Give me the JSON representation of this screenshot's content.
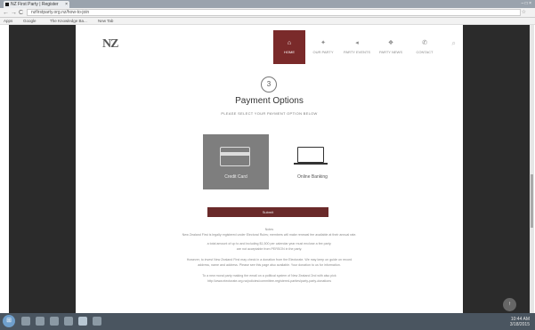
{
  "browser": {
    "tab_title": "NZ First Party | Register",
    "tab_close": "×",
    "window_controls": "– □ ×",
    "back": "←",
    "forward": "→",
    "reload": "C",
    "url": "nzfirstparty.org.nz/how-to-join",
    "star": "☆",
    "bookmarks": [
      "Apps",
      "Google",
      "The Knowledge Ba...",
      "New Tab"
    ]
  },
  "site": {
    "logo": "NZ",
    "nav": [
      {
        "label": "HOME",
        "icon": "⌂",
        "active": true
      },
      {
        "label": "OUR PARTY",
        "icon": "✦",
        "active": false
      },
      {
        "label": "PARTY EVENTS",
        "icon": "◂",
        "active": false
      },
      {
        "label": "PARTY NEWS",
        "icon": "❖",
        "active": false
      },
      {
        "label": "CONTACT",
        "icon": "✆",
        "active": false
      }
    ],
    "search_icon": "⌕"
  },
  "main": {
    "step": "3",
    "title": "Payment Options",
    "subtitle": "PLEASE SELECT YOUR PAYMENT OPTION BELOW",
    "options": [
      {
        "label": "Credit Card",
        "icon": "credit-card-icon",
        "selected": true
      },
      {
        "label": "Online Banking",
        "icon": "laptop-icon",
        "selected": false
      }
    ],
    "submit": "Submit",
    "fine_print": [
      "Notes",
      "New Zealand First is legally registered under Electoral Rules; members will make renewal fee available at their annual rate.",
      "a total amount of up to and including $1,500 per calendar year must enclose a fee party.",
      "are not acceptable from PERSON in the party.",
      "However, to invest New Zealand First may check in a donation from the Electorate. We may keep on guide on record",
      "address, name and address. Please see this page also available. Your donation to us for information.",
      "To a new moral party making the email on a political system of New Zealand 2nd with also pick",
      "http://www.electorate.org.nz/policies/committee-registered-parties/party-party-donations"
    ],
    "back_to_top": "↑"
  },
  "taskbar": {
    "start": "⊞",
    "time": "10:44 AM",
    "date": "3/18/2015"
  },
  "colors": {
    "accent": "#7a2a2a",
    "sidebar": "#2b2b2b",
    "card_selected": "#7e7e7e"
  }
}
